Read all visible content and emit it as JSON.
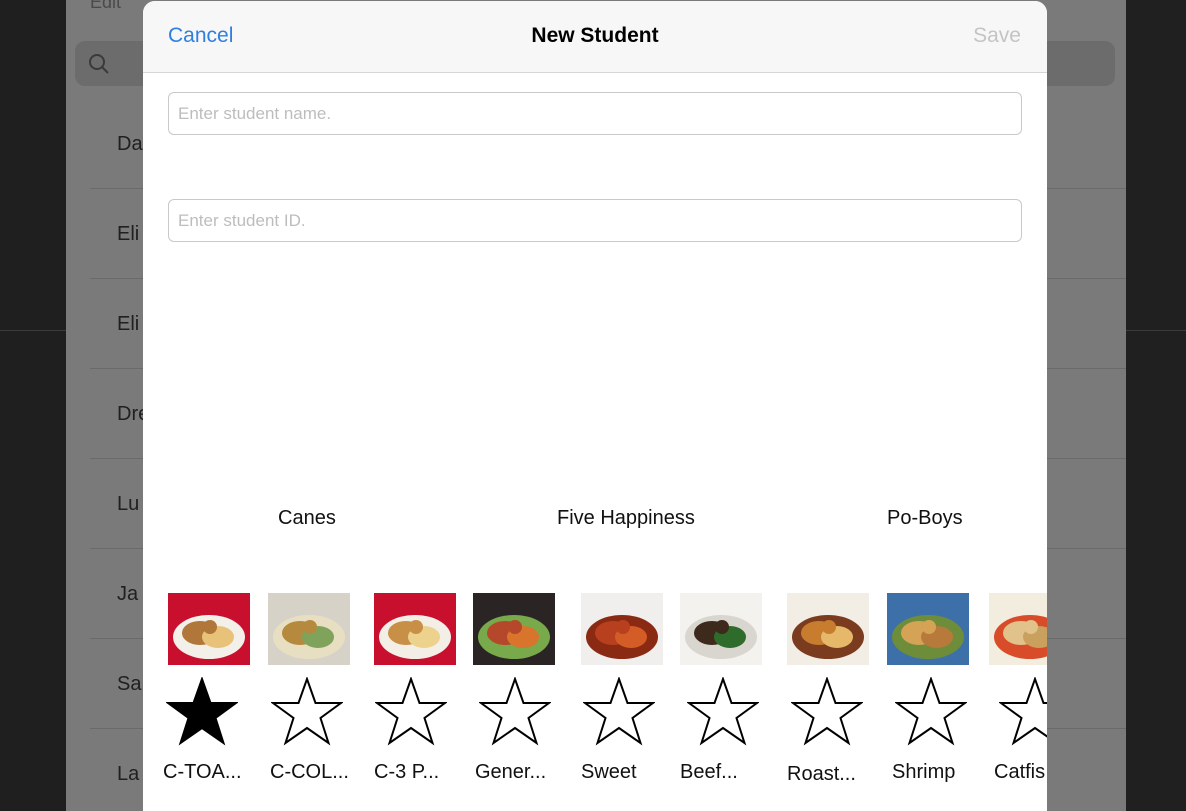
{
  "background": {
    "edit_label": "Edit",
    "rows": [
      "Da",
      "Eli",
      "Eli",
      "Dre",
      "Lu",
      "Ja",
      "Sa",
      "La"
    ]
  },
  "modal": {
    "cancel_label": "Cancel",
    "title": "New Student",
    "save_label": "Save",
    "name_placeholder": "Enter student name.",
    "id_placeholder": "Enter student ID."
  },
  "restaurants": [
    "Canes",
    "Five Happiness",
    "Po-Boys"
  ],
  "dishes": [
    {
      "label": "C-TOA...",
      "starred": true,
      "photo": "fried-chicken-basket"
    },
    {
      "label": "C-COL...",
      "starred": false,
      "photo": "chicken-coleslaw-box"
    },
    {
      "label": "C-3 P...",
      "starred": false,
      "photo": "chicken-fries-basket"
    },
    {
      "label": "Gener...",
      "starred": false,
      "photo": "general-tso-chicken"
    },
    {
      "label": "Sweet",
      "starred": false,
      "photo": "sweet-sour-chicken"
    },
    {
      "label": "Beef...",
      "starred": false,
      "photo": "beef-broccoli"
    },
    {
      "label": "Roast...",
      "starred": false,
      "photo": "roast-beef-poboy"
    },
    {
      "label": "Shrimp",
      "starred": false,
      "photo": "shrimp-poboy"
    },
    {
      "label": "Catfis",
      "starred": false,
      "photo": "catfish-plate"
    }
  ],
  "colors": {
    "accent": "#2f7fe0",
    "save_disabled": "#c4c4c4",
    "star_filled": "#000000",
    "star_empty": "#ffffff"
  }
}
